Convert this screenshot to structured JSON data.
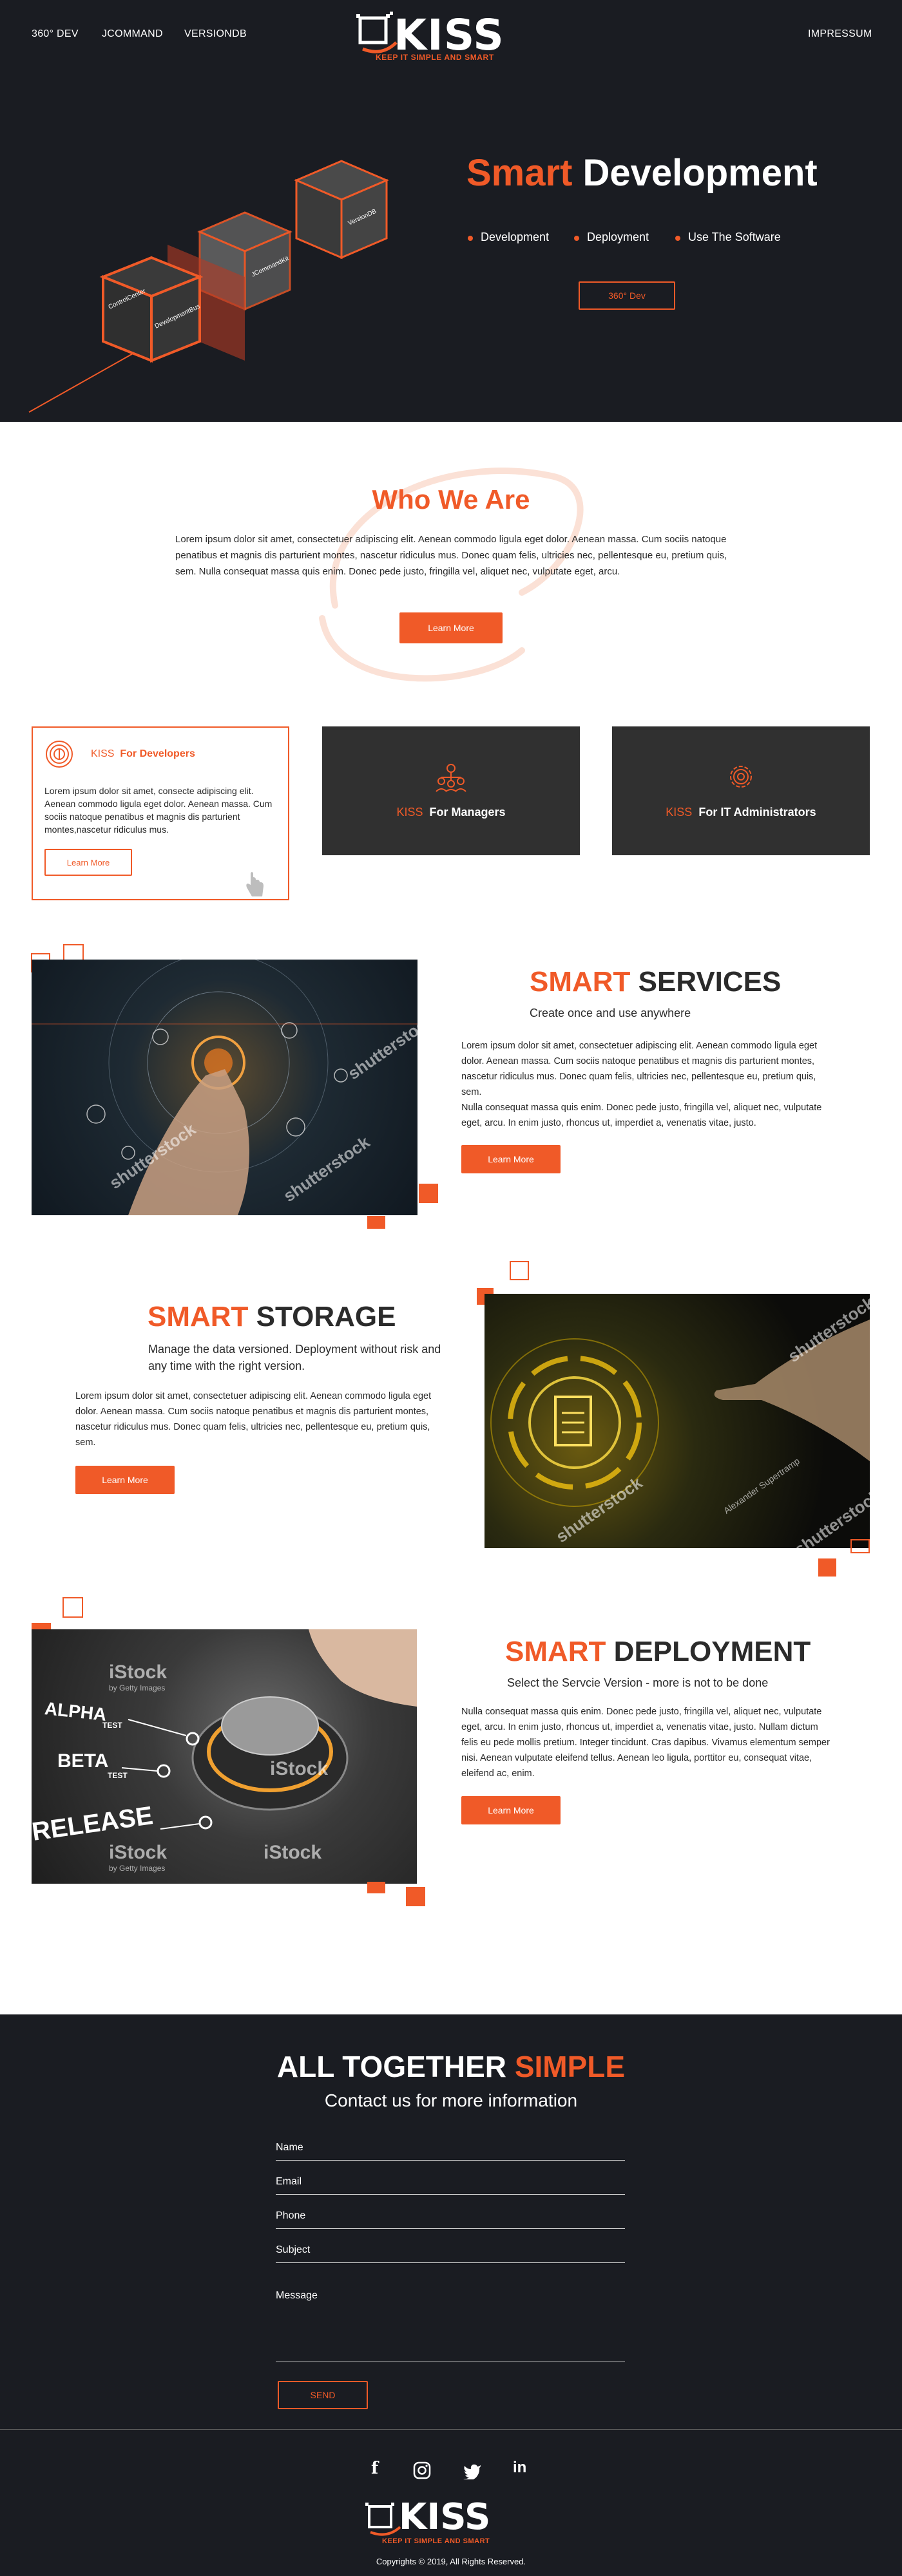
{
  "nav": {
    "links": [
      "360° DEV",
      "JCOMMAND",
      "VERSIONDB"
    ],
    "right_link": "IMPRESSUM"
  },
  "logo": {
    "name": "KISS",
    "tagline": "KEEP IT SIMPLE AND SMART"
  },
  "hero": {
    "title_accent": "Smart",
    "title_rest": " Development",
    "bullets": [
      "Development",
      "Deployment",
      "Use The Software"
    ],
    "button": "360° Dev",
    "cube_labels": [
      "ControlCenter",
      "ImplementEasy",
      "DevelopmentBus",
      "JCommandKit",
      "VersionDB"
    ]
  },
  "who": {
    "title": "Who We Are",
    "text": "Lorem ipsum dolor sit amet, consectetuer adipiscing elit. Aenean commodo ligula eget dolor. Aenean massa. Cum sociis natoque penatibus et magnis dis parturient montes, nascetur ridiculus mus. Donec quam felis, ultricies nec, pellentesque eu, pretium quis, sem. Nulla consequat massa quis enim. Donec pede justo, fringilla vel, aliquet nec, vulputate eget, arcu.",
    "button": "Learn More"
  },
  "cards": {
    "dev": {
      "brand": "KISS",
      "title": "For Developers",
      "text": "Lorem ipsum dolor sit amet, consecte adipiscing elit. Aenean commodo ligula eget dolor. Aenean massa. Cum sociis natoque penatibus et magnis dis parturient montes,nascetur ridiculus mus.",
      "button": "Learn More"
    },
    "managers": {
      "brand": "KISS",
      "title": "For Managers"
    },
    "admins": {
      "brand": "KISS",
      "title": "For IT Administrators"
    }
  },
  "services": {
    "title_accent": "SMART",
    "title_rest": " SERVICES",
    "subtitle": "Create once and use anywhere",
    "text1": "Lorem ipsum dolor sit amet, consectetuer adipiscing elit. Aenean commodo ligula eget dolor. Aenean massa. Cum sociis natoque penatibus et magnis dis parturient montes, nascetur ridiculus mus. Donec quam felis, ultricies nec, pellentesque eu, pretium quis, sem.",
    "text2": "Nulla consequat massa quis enim. Donec pede justo, fringilla vel, aliquet nec, vulputate eget, arcu. In enim justo, rhoncus ut, imperdiet a, venenatis vitae, justo.",
    "button": "Learn More",
    "watermark": "shutterstock"
  },
  "storage": {
    "title_accent": "SMART",
    "title_rest": " STORAGE",
    "subtitle": "Manage the data versioned. Deployment without risk and any time with the right version.",
    "text": "Lorem ipsum dolor sit amet, consectetuer adipiscing elit. Aenean commodo ligula eget dolor. Aenean massa. Cum sociis natoque penatibus et magnis dis parturient montes, nascetur ridiculus mus. Donec quam felis, ultricies nec, pellentesque eu, pretium quis, sem.",
    "button": "Learn More",
    "watermark": "shutterstock",
    "credit": "Alexander Supertramp"
  },
  "deployment": {
    "title_accent": "SMART",
    "title_rest": " DEPLOYMENT",
    "subtitle": "Select the Servcie Version - more is not to be done",
    "text": "Nulla consequat massa quis enim. Donec pede justo, fringilla vel, aliquet nec, vulputate eget, arcu. In enim justo, rhoncus ut, imperdiet a, venenatis vitae, justo. Nullam dictum felis eu pede mollis pretium. Integer tincidunt. Cras dapibus. Vivamus elementum semper nisi. Aenean vulputate eleifend tellus. Aenean leo ligula, porttitor eu, consequat vitae, eleifend ac, enim.",
    "button": "Learn More",
    "watermark": "iStock",
    "watermark_sub": "by Getty Images",
    "photo_labels": [
      "ALPHA",
      "TEST",
      "BETA",
      "TEST",
      "RELEASE"
    ]
  },
  "contact": {
    "title_main": "ALL TOGETHER ",
    "title_accent": "SIMPLE",
    "subtitle": "Contact us for more information",
    "fields": [
      "Name",
      "Email",
      "Phone",
      "Subject",
      "Message"
    ],
    "send": "SEND"
  },
  "footer": {
    "social": [
      "f",
      "instagram",
      "twitter",
      "in"
    ],
    "copyright": "Copyrights © 2019, All Rights Reserved."
  },
  "colors": {
    "accent": "#f05a28",
    "dark": "#1a1c22",
    "card": "#303030"
  }
}
